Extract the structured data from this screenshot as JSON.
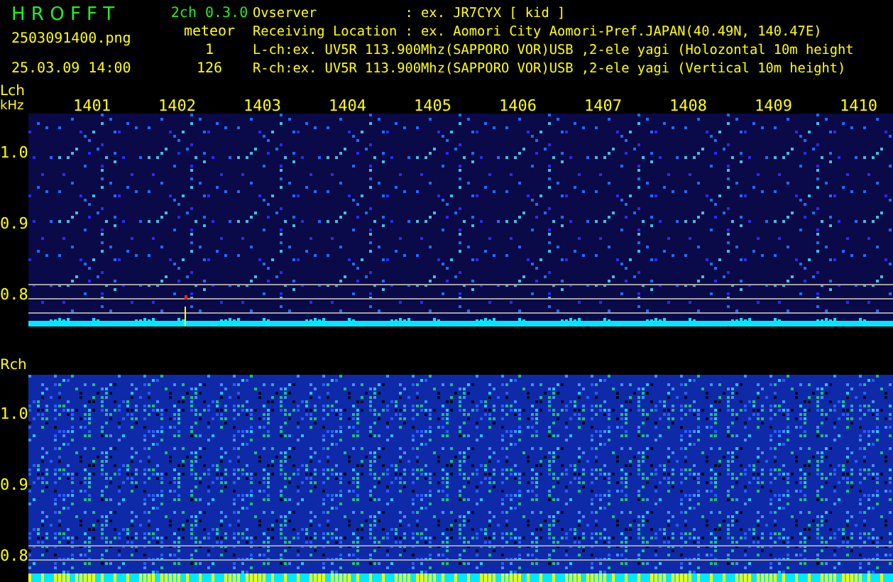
{
  "header": {
    "app_name": "H R O F F T",
    "version": "2ch 0.3.0",
    "file_name": "2503091400.png",
    "datetime": "25.03.09 14:00",
    "meteor_label": "meteor",
    "meteor_counts": [
      "1",
      "126"
    ],
    "info_lines": [
      "Ovserver           : ex. JR7CYX [ kid ]",
      "Receiving Location : ex. Aomori City Aomori-Pref.JAPAN(40.49N, 140.47E)",
      "L-ch:ex. UV5R 113.900Mhz(SAPPORO VOR)USB ,2-ele yagi (Holozontal 10m height",
      "R-ch:ex. UV5R 113.900Mhz(SAPPORO VOR)USB ,2-ele yagi (Vertical 10m height)"
    ]
  },
  "lch": {
    "label": "Lch",
    "unit": "kHz",
    "time_labels": [
      "1401",
      "1402",
      "1403",
      "1404",
      "1405",
      "1406",
      "1407",
      "1408",
      "1409",
      "1410"
    ],
    "freq_labels": [
      "1.0",
      "0.9",
      "0.8"
    ]
  },
  "rch": {
    "label": "Rch",
    "freq_labels": [
      "1.0",
      "0.9",
      "0.8"
    ]
  }
}
